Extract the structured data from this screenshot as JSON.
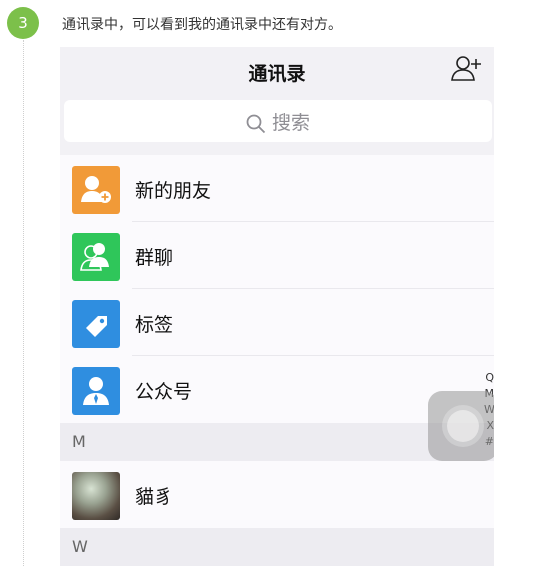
{
  "step": {
    "number": "3",
    "text": "通讯录中，可以看到我的通讯录中还有对方。"
  },
  "phone": {
    "nav_title": "通讯录",
    "search_placeholder": "搜索",
    "items": [
      {
        "label": "新的朋友",
        "color": "#f19a38",
        "icon": "new-friend-icon"
      },
      {
        "label": "群聊",
        "color": "#2fc65a",
        "icon": "group-chat-icon"
      },
      {
        "label": "标签",
        "color": "#2f8ee0",
        "icon": "tag-icon"
      },
      {
        "label": "公众号",
        "color": "#2f8ee0",
        "icon": "official-account-icon"
      }
    ],
    "sections": [
      {
        "letter": "M",
        "contacts": [
          {
            "name": "貓豸"
          }
        ]
      },
      {
        "letter": "W",
        "contacts": []
      }
    ],
    "index_letters": [
      "Q",
      "M",
      "W",
      "X",
      "#"
    ]
  }
}
